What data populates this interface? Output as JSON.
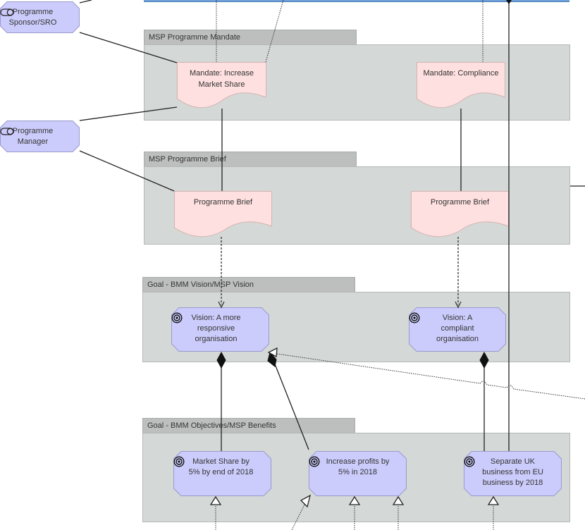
{
  "actors": [
    {
      "id": "sponsor",
      "label": "Programme Sponsor/SRO",
      "icon": "role-icon"
    },
    {
      "id": "manager",
      "label": "Programme Manager",
      "icon": "role-icon"
    }
  ],
  "groups": [
    {
      "id": "mandate",
      "label": "MSP Programme Mandate"
    },
    {
      "id": "brief",
      "label": "MSP Programme Brief"
    },
    {
      "id": "vision",
      "label": "Goal - BMM Vision/MSP Vision"
    },
    {
      "id": "objectives",
      "label": "Goal - BMM Objectives/MSP Benefits"
    }
  ],
  "documents": [
    {
      "id": "mandate-market",
      "label": "Mandate: Increase Market Share"
    },
    {
      "id": "mandate-compliance",
      "label": "Mandate: Compliance"
    },
    {
      "id": "brief-left",
      "label": "Programme Brief"
    },
    {
      "id": "brief-right",
      "label": "Programme Brief"
    }
  ],
  "goals": [
    {
      "id": "vision-responsive",
      "label": "Vision: A more responsive organisation",
      "icon": "goal-target-icon"
    },
    {
      "id": "vision-compliant",
      "label": "Vision: A compliant organisation",
      "icon": "goal-target-icon"
    },
    {
      "id": "obj-market",
      "label": "Market Share by 5% by end of 2018",
      "icon": "goal-target-icon"
    },
    {
      "id": "obj-profits",
      "label": "Increase profits by 5% in 2018",
      "icon": "goal-target-icon"
    },
    {
      "id": "obj-separate",
      "label": "Separate UK business from EU business by 2018",
      "icon": "goal-target-icon"
    }
  ],
  "colors": {
    "group_fill": "#d4d8d7",
    "group_tab": "#bdbfbf",
    "document_fill": "#fde0df",
    "goal_fill": "#ccccfc",
    "actor_fill": "#ccccfc",
    "top_element": "#6f9fd8"
  }
}
